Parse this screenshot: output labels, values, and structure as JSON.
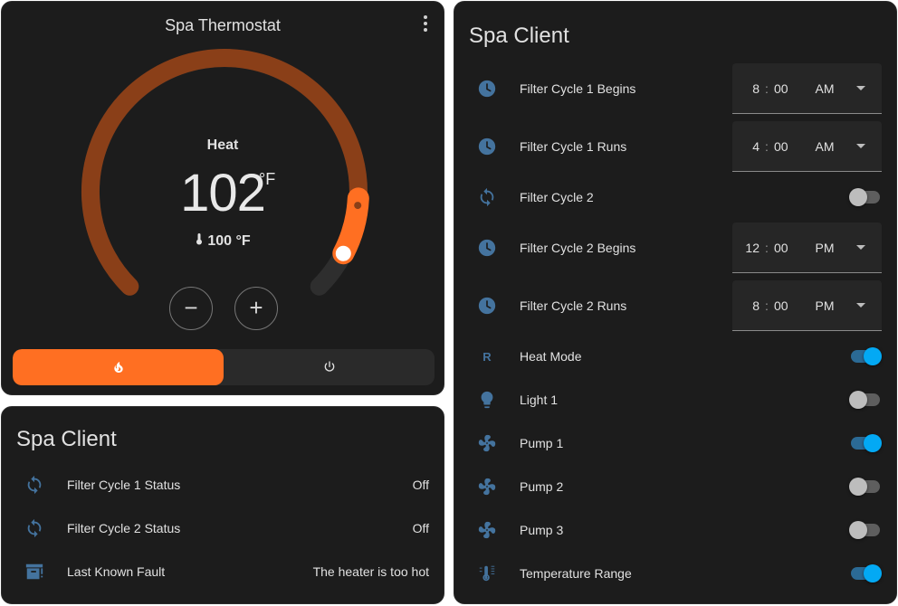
{
  "colors": {
    "accent": "#ff6f22",
    "icon": "#44739e",
    "toggle_on": "#03a9f4"
  },
  "thermostat": {
    "title": "Spa Thermostat",
    "mode_label": "Heat",
    "target_temp": "102",
    "unit": "°F",
    "current_temp": "100 °F",
    "target_fraction": 0.855,
    "current_fraction": 0.935,
    "minus_symbol": "−",
    "plus_symbol": "+",
    "modes": [
      {
        "icon": "fire-icon",
        "active": true
      },
      {
        "icon": "power-icon",
        "active": false
      }
    ]
  },
  "client1": {
    "title": "Spa Client",
    "rows": [
      {
        "icon": "sync-icon",
        "label": "Filter Cycle 1 Status",
        "value": "Off"
      },
      {
        "icon": "sync-icon",
        "label": "Filter Cycle 2 Status",
        "value": "Off"
      },
      {
        "icon": "alert-box-icon",
        "label": "Last Known Fault",
        "value": "The heater is too hot"
      }
    ]
  },
  "client2": {
    "title": "Spa Client",
    "time_rows": [
      {
        "icon": "clock-icon",
        "label": "Filter Cycle 1 Begins",
        "hour": "8",
        "minute": "00",
        "ampm": "AM"
      },
      {
        "icon": "clock-icon",
        "label": "Filter Cycle 1 Runs",
        "hour": "4",
        "minute": "00",
        "ampm": "AM"
      },
      {
        "icon": "clock-icon",
        "label": "Filter Cycle 2 Begins",
        "hour": "12",
        "minute": "00",
        "ampm": "PM"
      },
      {
        "icon": "clock-icon",
        "label": "Filter Cycle 2 Runs",
        "hour": "8",
        "minute": "00",
        "ampm": "PM"
      }
    ],
    "time_separator": ":",
    "toggle_rows": [
      {
        "icon": "sync-icon",
        "label": "Filter Cycle 2",
        "on": false
      },
      {
        "icon": "r-letter-icon",
        "glyph": "R",
        "label": "Heat Mode",
        "on": true
      },
      {
        "icon": "lightbulb-icon",
        "label": "Light 1",
        "on": false
      },
      {
        "icon": "fan-icon",
        "label": "Pump 1",
        "on": true
      },
      {
        "icon": "fan-icon",
        "label": "Pump 2",
        "on": false
      },
      {
        "icon": "fan-icon",
        "label": "Pump 3",
        "on": false
      },
      {
        "icon": "thermometer-lines-icon",
        "label": "Temperature Range",
        "on": true
      }
    ]
  }
}
